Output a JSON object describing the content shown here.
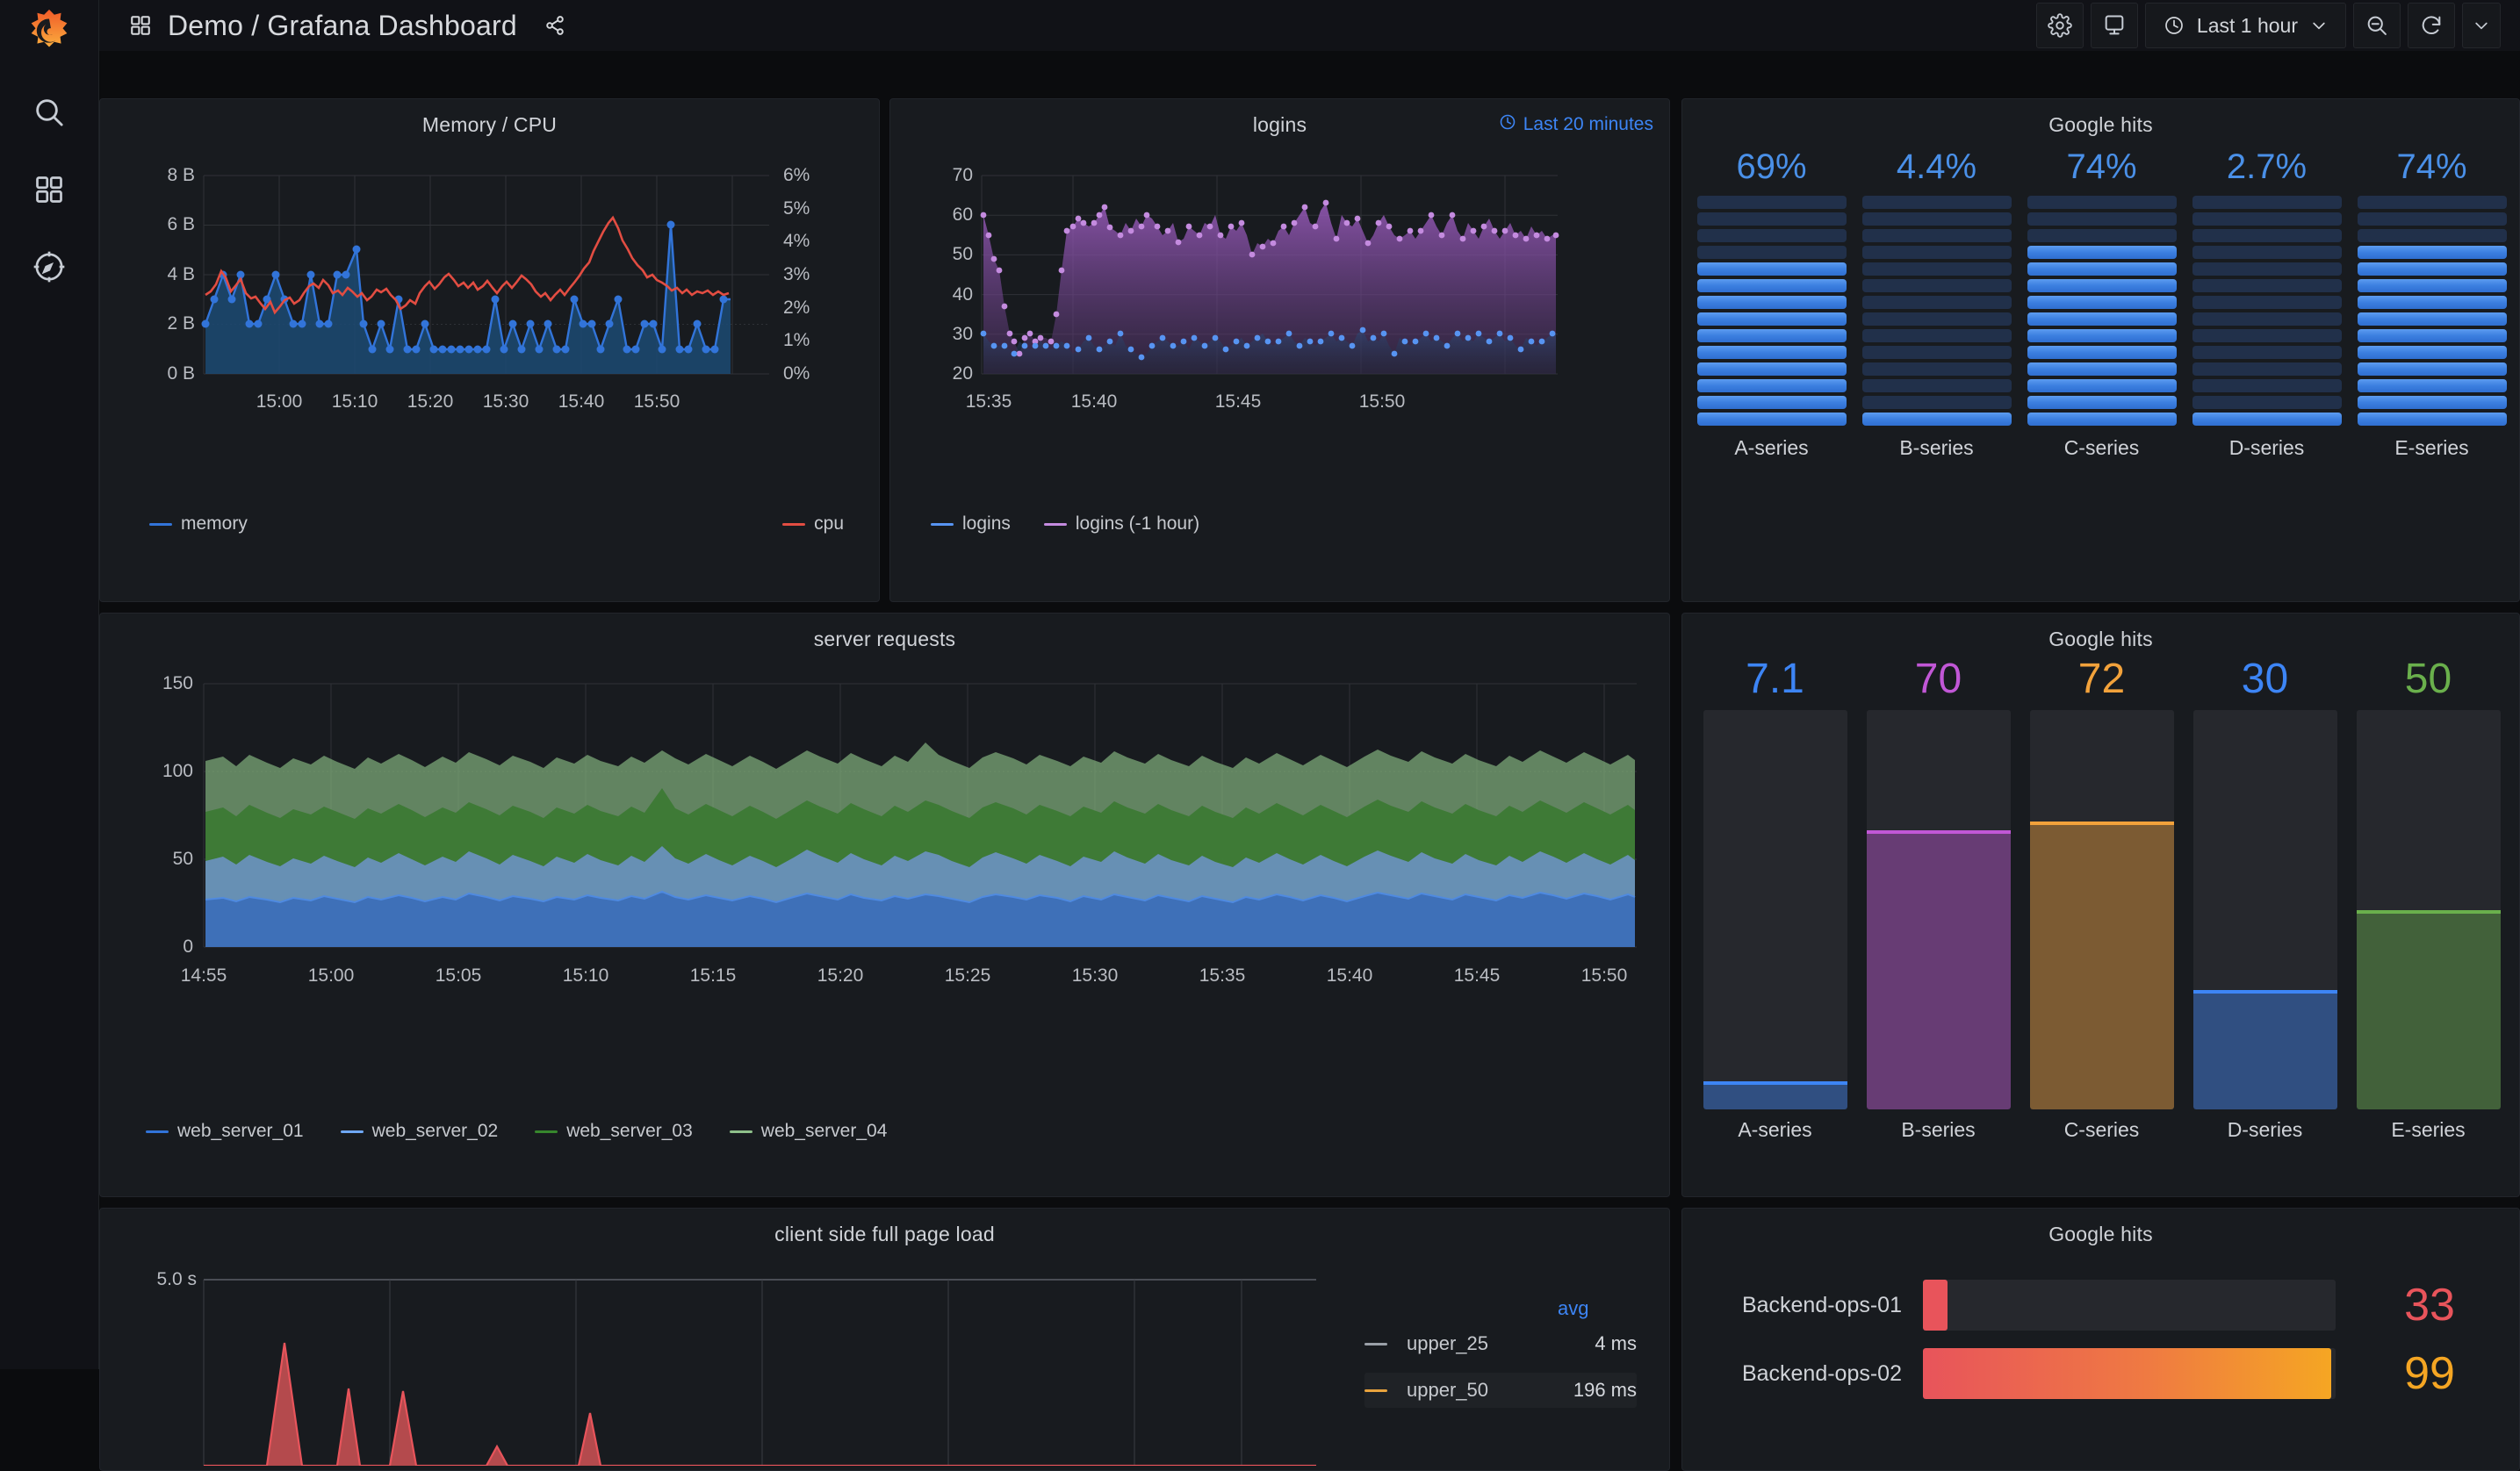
{
  "app": {
    "logo": "grafana-logo",
    "nav_title": "Demo / Grafana Dashboard",
    "dashboards_icon": "dashboards-grid-icon",
    "share_icon": "share-icon"
  },
  "sidebar": {
    "items": [
      {
        "icon": "search-icon",
        "label": "Search"
      },
      {
        "icon": "dashboards-icon",
        "label": "Dashboards"
      },
      {
        "icon": "compass-explore-icon",
        "label": "Explore"
      }
    ]
  },
  "toolbar": {
    "settings_icon": "gear-icon",
    "tv_icon": "tv-kiosk-icon",
    "time_range": "Last 1 hour",
    "time_icon": "clock-icon",
    "time_chevron": "chevron-down-icon",
    "zoom_out_icon": "zoom-out-icon",
    "refresh_icon": "refresh-icon",
    "refresh_chevron": "chevron-down-icon"
  },
  "panels": {
    "memory_cpu": {
      "title": "Memory / CPU",
      "y_left": [
        "8 B",
        "6 B",
        "4 B",
        "2 B",
        "0 B"
      ],
      "y_right": [
        "6%",
        "5%",
        "4%",
        "3%",
        "2%",
        "1%",
        "0%"
      ],
      "x_ticks": [
        "15:00",
        "15:10",
        "15:20",
        "15:30",
        "15:40",
        "15:50"
      ],
      "legend": [
        {
          "name": "memory",
          "color": "#3274d9"
        },
        {
          "name": "cpu",
          "color": "#e24d42"
        }
      ]
    },
    "logins": {
      "title": "logins",
      "time_badge": "Last 20 minutes",
      "y_ticks": [
        "70",
        "60",
        "50",
        "40",
        "30",
        "20"
      ],
      "x_ticks": [
        "15:35",
        "15:40",
        "15:45",
        "15:50"
      ],
      "legend": [
        {
          "name": "logins",
          "color": "#5794f2"
        },
        {
          "name": "logins (-1 hour)",
          "color": "#c48bdf"
        }
      ]
    },
    "google_hits_led": {
      "title": "Google hits",
      "segments_total": 14,
      "series": [
        {
          "name": "A-series",
          "value": "69%",
          "lit": 10,
          "color": "#4a90e8"
        },
        {
          "name": "B-series",
          "value": "4.4%",
          "lit": 1,
          "color": "#4a90e8"
        },
        {
          "name": "C-series",
          "value": "74%",
          "lit": 11,
          "color": "#4a90e8"
        },
        {
          "name": "D-series",
          "value": "2.7%",
          "lit": 1,
          "color": "#4a90e8"
        },
        {
          "name": "E-series",
          "value": "74%",
          "lit": 11,
          "color": "#4a90e8"
        }
      ]
    },
    "server_requests": {
      "title": "server requests",
      "y_ticks": [
        "150",
        "100",
        "50",
        "0"
      ],
      "x_ticks": [
        "14:55",
        "15:00",
        "15:05",
        "15:10",
        "15:15",
        "15:20",
        "15:25",
        "15:30",
        "15:35",
        "15:40",
        "15:45",
        "15:50"
      ],
      "legend": [
        {
          "name": "web_server_01",
          "color": "#3274d9"
        },
        {
          "name": "web_server_02",
          "color": "#6fa8f5"
        },
        {
          "name": "web_server_03",
          "color": "#37872d"
        },
        {
          "name": "web_server_04",
          "color": "#8ec08a"
        }
      ]
    },
    "google_hits_vbar": {
      "title": "Google hits",
      "max": 100,
      "series": [
        {
          "name": "A-series",
          "value": "7.1",
          "pct": 7.1,
          "color": "#3d85f5"
        },
        {
          "name": "B-series",
          "value": "70",
          "pct": 70,
          "color": "#c157d6"
        },
        {
          "name": "C-series",
          "value": "72",
          "pct": 72,
          "color": "#f2a23b"
        },
        {
          "name": "D-series",
          "value": "30",
          "pct": 30,
          "color": "#3d85f5"
        },
        {
          "name": "E-series",
          "value": "50",
          "pct": 50,
          "color": "#6ab04c"
        }
      ]
    },
    "client_page_load": {
      "title": "client side full page load",
      "y_ticks": [
        "5.0 s"
      ],
      "legend_header": "avg",
      "legend_rows": [
        {
          "name": "upper_25",
          "value": "4 ms",
          "color": "#9aa0a8"
        },
        {
          "name": "upper_50",
          "value": "196 ms",
          "color": "#e8a33d"
        }
      ]
    },
    "google_hits_hbar": {
      "title": "Google hits",
      "max": 100,
      "rows": [
        {
          "name": "Backend-ops-01",
          "value": "33",
          "pct": 6,
          "color": "#e8545b"
        },
        {
          "name": "Backend-ops-02",
          "value": "99",
          "pct": 99,
          "color": "#f5a623"
        }
      ]
    }
  },
  "chart_data": [
    {
      "type": "line",
      "title": "Memory / CPU",
      "xlabel": "",
      "ylabel": "",
      "x_ticks": [
        "15:00",
        "15:10",
        "15:20",
        "15:30",
        "15:40",
        "15:50"
      ],
      "ylim": [
        0,
        8
      ],
      "y2lim": [
        0,
        6
      ],
      "grid": true,
      "legend_position": "bottom",
      "series": [
        {
          "name": "memory",
          "color": "#3274d9",
          "axis": "left",
          "unit": "B",
          "fill": true,
          "values": [
            2,
            3,
            4,
            3,
            4,
            2,
            2,
            3,
            4,
            3,
            2,
            2,
            4,
            2,
            2,
            4,
            4,
            5,
            1,
            2,
            1,
            3,
            1,
            1,
            2,
            1,
            1,
            1,
            1,
            1,
            1,
            1,
            3,
            1,
            2,
            1,
            2,
            1,
            2,
            1,
            2,
            1,
            1,
            3,
            2,
            2,
            1,
            2,
            3,
            1,
            1,
            2,
            2,
            1,
            6,
            1,
            1,
            2,
            1,
            1,
            3
          ]
        },
        {
          "name": "cpu",
          "color": "#e24d42",
          "axis": "right",
          "unit": "%",
          "fill": false,
          "values": [
            2.4,
            2.6,
            3.2,
            2.7,
            3.0,
            2.4,
            2.3,
            2.2,
            2.0,
            2.2,
            2.4,
            2.3,
            2.5,
            2.4,
            2.6,
            2.9,
            3.0,
            2.8,
            2.9,
            2.7,
            2.8,
            2.7,
            2.6,
            2.7,
            2.3,
            2.1,
            2.0,
            2.3,
            2.5,
            2.6,
            2.9,
            3.1,
            2.8,
            3.0,
            2.7,
            2.8,
            2.9,
            3.0,
            2.8,
            2.5,
            2.4,
            2.4,
            2.5,
            2.6,
            3.3,
            4.6,
            5.1,
            4.8,
            4.3,
            3.8,
            3.4,
            3.2,
            3.1,
            2.9
          ]
        }
      ]
    },
    {
      "type": "area",
      "title": "logins",
      "x_ticks": [
        "15:35",
        "15:40",
        "15:45",
        "15:50"
      ],
      "ylim": [
        20,
        70
      ],
      "grid": true,
      "legend_position": "bottom",
      "series": [
        {
          "name": "logins",
          "color": "#5794f2",
          "values": [
            30,
            29,
            28,
            28,
            28,
            27,
            26,
            29,
            28,
            27,
            28,
            29,
            28,
            27,
            28,
            29,
            28,
            26,
            27,
            28,
            29,
            27,
            27,
            28,
            29,
            28,
            31,
            28,
            27,
            26,
            25,
            26,
            28,
            29,
            30,
            29,
            28,
            28,
            29,
            27,
            30,
            29,
            28,
            29,
            30,
            29,
            27,
            28,
            29,
            30,
            28,
            29,
            30,
            31,
            29,
            28,
            29,
            30,
            31,
            29,
            28,
            30,
            29,
            28,
            29,
            30,
            31,
            29,
            30,
            29,
            31,
            32,
            29,
            30,
            29,
            31,
            28,
            26,
            30,
            29,
            28,
            29,
            30
          ]
        },
        {
          "name": "logins (-1 hour)",
          "color": "#c48bdf",
          "values": [
            60,
            55,
            49,
            46,
            37,
            29,
            27,
            25,
            29,
            30,
            28,
            29,
            29,
            28,
            35,
            46,
            56,
            57,
            59,
            58,
            57,
            58,
            60,
            62,
            57,
            56,
            55,
            58,
            56,
            59,
            57,
            60,
            59,
            57,
            55,
            56,
            58,
            53,
            54,
            57,
            56,
            55,
            58,
            57,
            60,
            55,
            54,
            57,
            56,
            58,
            55,
            50,
            53,
            52,
            54,
            53,
            56,
            57,
            55,
            58,
            60,
            62,
            58,
            57,
            61,
            63,
            58,
            54,
            60,
            58,
            57,
            59,
            56,
            53,
            55,
            58,
            60,
            57,
            55,
            54,
            55,
            56
          ]
        }
      ]
    },
    {
      "type": "bar",
      "title": "Google hits",
      "subtitle": "LED bar gauge",
      "categories": [
        "A-series",
        "B-series",
        "C-series",
        "D-series",
        "E-series"
      ],
      "values": [
        69,
        4.4,
        74,
        2.7,
        74
      ],
      "value_labels": [
        "69%",
        "4.4%",
        "74%",
        "2.7%",
        "74%"
      ],
      "ylim": [
        0,
        100
      ],
      "unit": "percent"
    },
    {
      "type": "area",
      "title": "server requests",
      "x_ticks": [
        "14:55",
        "15:00",
        "15:05",
        "15:10",
        "15:15",
        "15:20",
        "15:25",
        "15:30",
        "15:35",
        "15:40",
        "15:45",
        "15:50"
      ],
      "ylim": [
        0,
        150
      ],
      "grid": true,
      "stacked": true,
      "legend_position": "bottom",
      "series": [
        {
          "name": "web_server_01",
          "color": "#3274d9",
          "approx_mean": 27
        },
        {
          "name": "web_server_02",
          "color": "#6fa8f5",
          "approx_mean": 28
        },
        {
          "name": "web_server_03",
          "color": "#37872d",
          "approx_mean": 31
        },
        {
          "name": "web_server_04",
          "color": "#8ec08a",
          "approx_mean": 25
        }
      ]
    },
    {
      "type": "bar",
      "title": "Google hits",
      "subtitle": "vertical bar gauge",
      "categories": [
        "A-series",
        "B-series",
        "C-series",
        "D-series",
        "E-series"
      ],
      "values": [
        7.1,
        70,
        72,
        30,
        50
      ],
      "ylim": [
        0,
        100
      ],
      "colors": [
        "#3d85f5",
        "#c157d6",
        "#f2a23b",
        "#3d85f5",
        "#6ab04c"
      ]
    },
    {
      "type": "line",
      "title": "client side full page load",
      "ylim": [
        0,
        5
      ],
      "ylabel": "s",
      "series": [
        {
          "name": "upper_25",
          "color": "#9aa0a8",
          "avg": "4 ms"
        },
        {
          "name": "upper_50",
          "color": "#e8a33d",
          "avg": "196 ms"
        }
      ]
    },
    {
      "type": "bar",
      "title": "Google hits",
      "subtitle": "horizontal bar gauge",
      "categories": [
        "Backend-ops-01",
        "Backend-ops-02"
      ],
      "values": [
        33,
        99
      ],
      "ylim": [
        0,
        100
      ],
      "orientation": "horizontal"
    }
  ]
}
